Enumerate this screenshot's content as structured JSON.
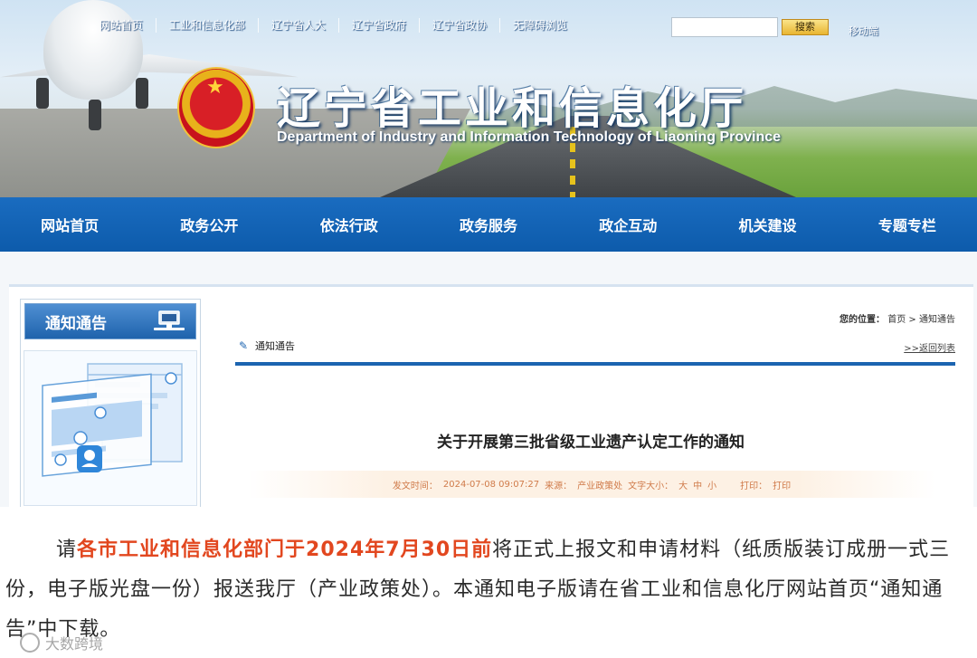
{
  "banner": {
    "title_cn": "辽宁省工业和信息化厅",
    "title_en": "Department of Industry and Information Technology of Liaoning Province",
    "top_links": [
      "网站首页",
      "工业和信息化部",
      "辽宁省人大",
      "辽宁省政府",
      "辽宁省政协",
      "无障碍浏览"
    ],
    "search_placeholder": "",
    "search_button": "搜索",
    "top_right_text": "移动端"
  },
  "nav": {
    "items": [
      "网站首页",
      "政务公开",
      "依法行政",
      "政务服务",
      "政企互动",
      "机关建设",
      "专题专栏"
    ]
  },
  "sidebar": {
    "title": "通知通告"
  },
  "main": {
    "location_label": "您的位置：",
    "breadcrumb": [
      "首页",
      "通知通告"
    ],
    "breadcrumb_sep": ">",
    "category": "通知通告",
    "back_link": ">>返回列表",
    "article_title": "关于开展第三批省级工业遗产认定工作的通知",
    "meta": {
      "date_label": "发文时间：",
      "date": "2024-07-08 09:07:27",
      "source_label": "来源：",
      "source": "产业政策处",
      "font_label": "文字大小：",
      "font_sizes": [
        "大",
        "中",
        "小"
      ],
      "print_label": "打印：",
      "print": "打印"
    }
  },
  "paragraph": {
    "before": "请",
    "highlight": "各市工业和信息化部门于2024年7月30日前",
    "after": "将正式上报文和申请材料（纸质版装订成册一式三份，电子版光盘一份）报送我厅（产业政策处）。本通知电子版请在省工业和信息化厅网站首页“通知通告”中下载。"
  },
  "watermark": "大数跨境",
  "colors": {
    "nav_blue": "#0d5bab",
    "highlight_red": "#e2471f",
    "meta_orange": "#d07b4a"
  }
}
